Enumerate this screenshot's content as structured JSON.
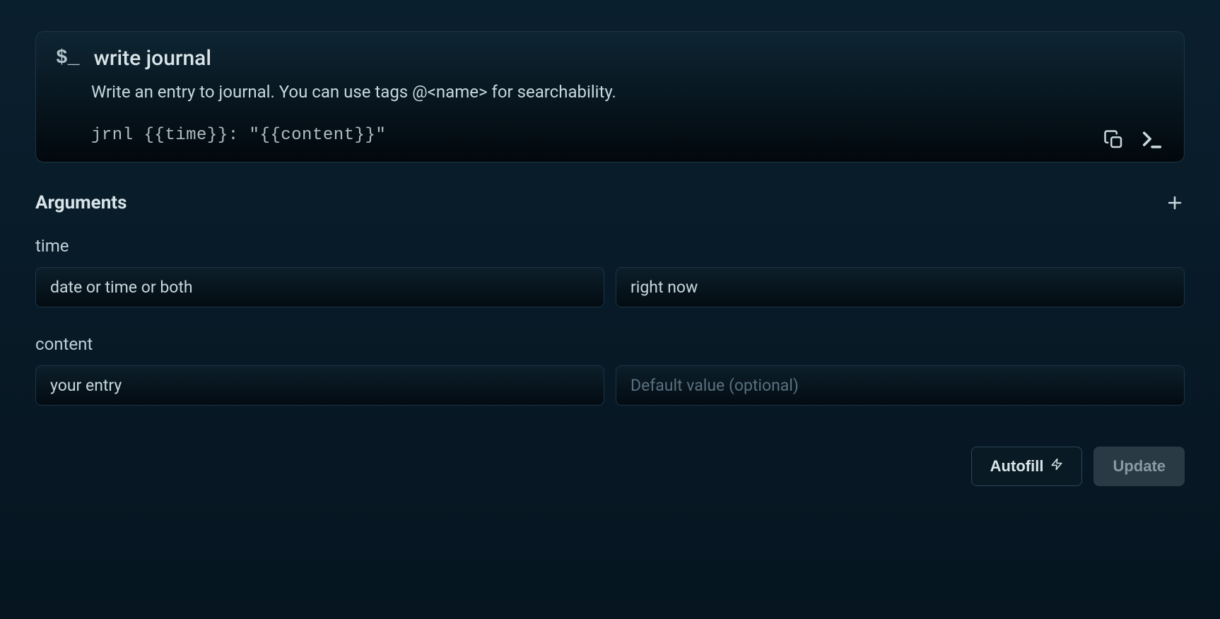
{
  "command": {
    "icon": "$_",
    "title": "write journal",
    "description": "Write an entry to journal. You can use tags @<name> for searchability.",
    "template": "jrnl {{time}}: \"{{content}}\""
  },
  "arguments": {
    "heading": "Arguments",
    "items": [
      {
        "name": "time",
        "value": "date or time or both",
        "default": "right now",
        "default_placeholder": "Default value (optional)"
      },
      {
        "name": "content",
        "value": "your entry",
        "default": "",
        "default_placeholder": "Default value (optional)"
      }
    ]
  },
  "footer": {
    "autofill_label": "Autofill",
    "update_label": "Update"
  }
}
